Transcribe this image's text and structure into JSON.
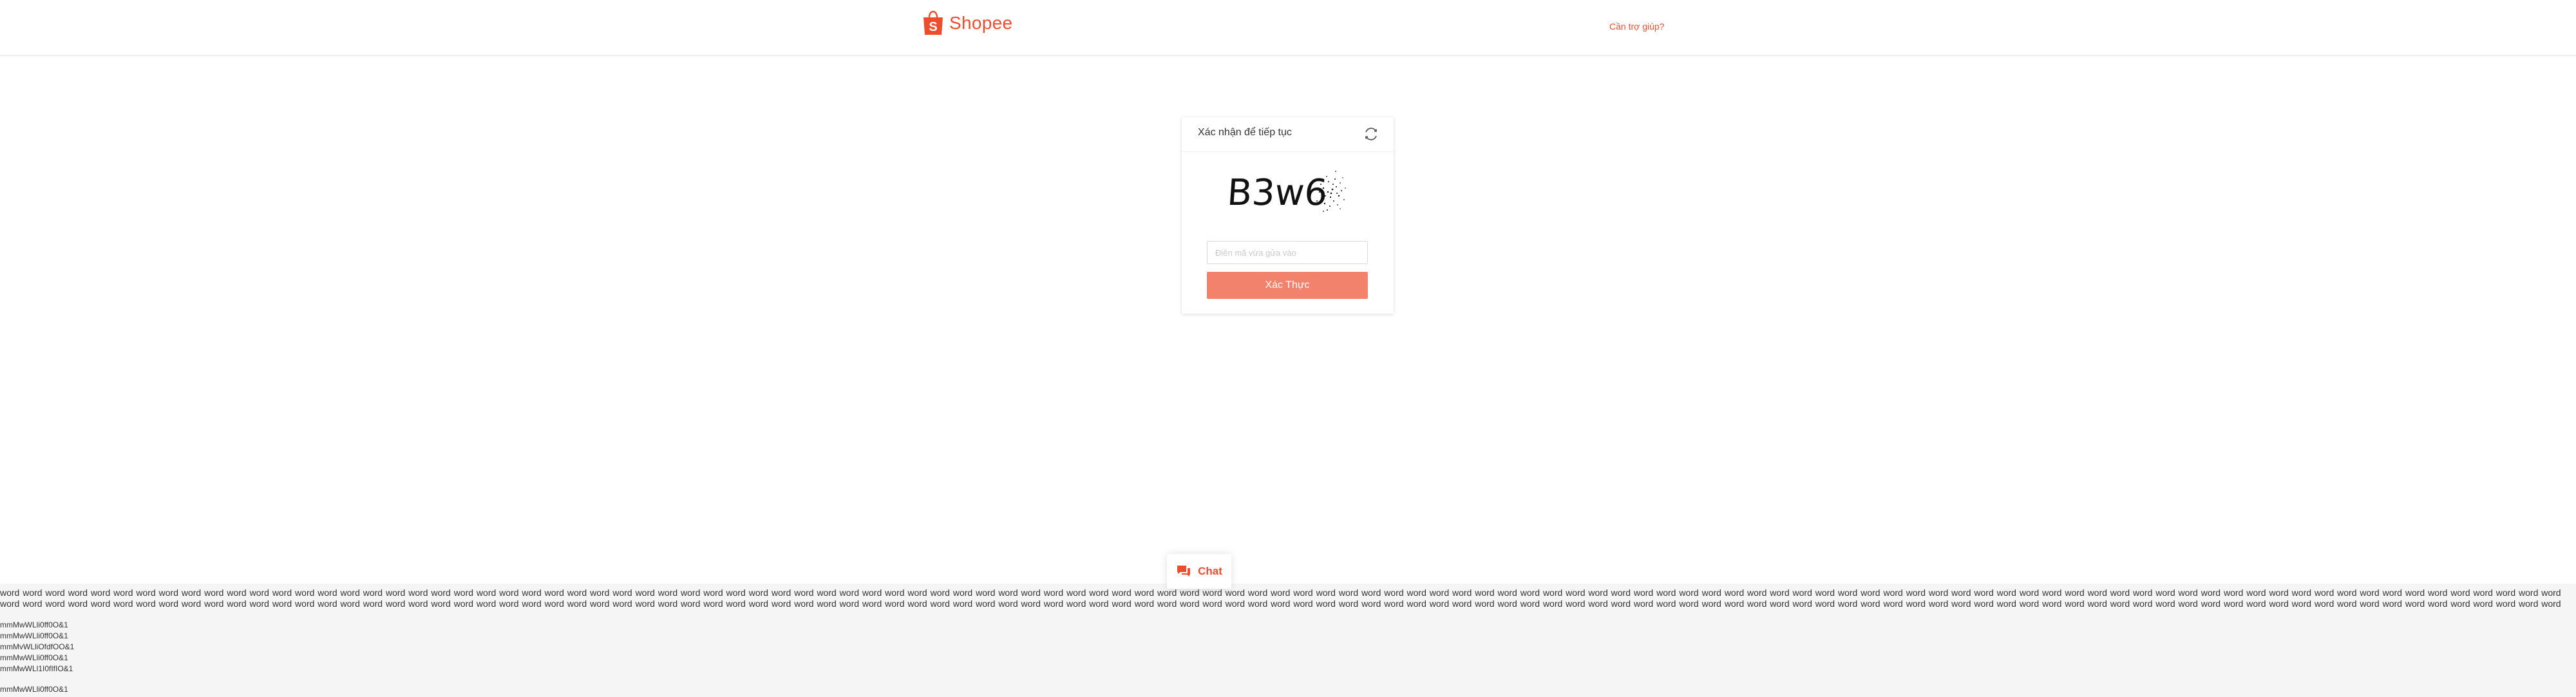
{
  "header": {
    "brand": "Shopee",
    "help_link": "Cần trợ giúp?"
  },
  "captcha": {
    "title": "Xác nhận để tiếp tục",
    "image_text": "B3w6",
    "input_placeholder": "Điền mã vừa gửa vào",
    "input_value": "",
    "submit_label": "Xác Thực",
    "icons": {
      "refresh": "refresh-icon"
    }
  },
  "chat": {
    "label": "Chat",
    "icon": "chat-bubble-icon"
  },
  "footer": {
    "word_text": "word word word word word word word word word word word word word word word word word word word word word word word word word word word word word word word word word word word word word word word word word word word word word word word word word word word word word word word word word word word word word word word word word word word word word word word word word word word word word word word word word word word word word word word word word word word word word word word word word word word word word word word word word word word word word word word word word word word word word word word word word word word word word word word word word word word word word word word word word word word word word word word word word word word word word word word word word word word word word word word word word word word word word word word word word word word word word word word word word word word word word word word word word word word word word word word word word word word word word word word word word word word word word word word word word word word word word word word word word word word word word word word word word word word word word word word word word word word word word word word word word word word word word word word word word word word word word word word word word word word word word word word word word word word word word word word word word word word word word",
    "glyph_lines": [
      "mmMwWLli0ff0O&1",
      "mmMwWLli0ff0O&1",
      "mmMvWLliOfdfOO&1",
      "mmMwWLli0ff0O&1",
      "mmMwWLl1I0fIfIO&1"
    ],
    "glyph_last": "mmMwWLli0ff0O&1"
  },
  "colors": {
    "brand": "#ee4d2d",
    "button": "#f3826c",
    "footer_bg": "#f5f5f5"
  }
}
